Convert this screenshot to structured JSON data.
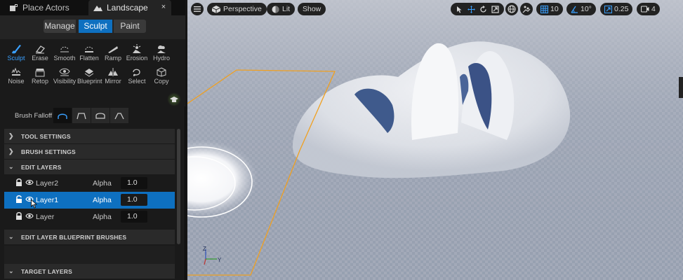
{
  "tabs": [
    {
      "label": "Place Actors",
      "icon": "place-actors-icon"
    },
    {
      "label": "Landscape",
      "icon": "landscape-icon",
      "close": "×"
    }
  ],
  "modes": [
    "Manage",
    "Sculpt",
    "Paint"
  ],
  "active_mode": "Sculpt",
  "tools_row1": [
    {
      "label": "Sculpt",
      "icon": "sculpt-brush-icon",
      "active": true
    },
    {
      "label": "Erase",
      "icon": "erase-icon"
    },
    {
      "label": "Smooth",
      "icon": "smooth-icon"
    },
    {
      "label": "Flatten",
      "icon": "flatten-icon"
    },
    {
      "label": "Ramp",
      "icon": "ramp-icon"
    },
    {
      "label": "Erosion",
      "icon": "erosion-icon"
    },
    {
      "label": "Hydro",
      "icon": "hydro-icon"
    }
  ],
  "tools_row2": [
    {
      "label": "Noise",
      "icon": "noise-icon"
    },
    {
      "label": "Retop",
      "icon": "retop-icon"
    },
    {
      "label": "Visibility",
      "icon": "visibility-icon"
    },
    {
      "label": "Blueprint",
      "icon": "blueprint-icon"
    },
    {
      "label": "Mirror",
      "icon": "mirror-icon"
    },
    {
      "label": "Select",
      "icon": "select-icon"
    },
    {
      "label": "Copy",
      "icon": "copy-icon"
    }
  ],
  "brush_falloff": {
    "label": "Brush Falloff",
    "options": [
      "smooth-falloff-icon",
      "linear-falloff-icon",
      "spherical-falloff-icon",
      "tip-falloff-icon"
    ],
    "active_index": 0
  },
  "sections": {
    "tool_settings": "TOOL SETTINGS",
    "brush_settings": "BRUSH SETTINGS",
    "edit_layers": "EDIT LAYERS",
    "blueprint_brushes": "EDIT LAYER BLUEPRINT BRUSHES",
    "target_layers": "TARGET LAYERS"
  },
  "layers": [
    {
      "name": "Layer2",
      "blend": "Alpha",
      "value": "1.0",
      "selected": false
    },
    {
      "name": "Layer1",
      "blend": "Alpha",
      "value": "1.0",
      "selected": true
    },
    {
      "name": "Layer",
      "blend": "Alpha",
      "value": "1.0",
      "selected": false
    }
  ],
  "viewport": {
    "view_mode": "Perspective",
    "lit": "Lit",
    "show": "Show",
    "grid_snap": "10",
    "rotation_snap": "10°",
    "scale_snap": "0.25",
    "camera_speed": "4",
    "axis_labels": {
      "z": "Z",
      "y": "Y"
    },
    "colors": {
      "selection_outline": "#f0a020",
      "sky": "#9ea5b4",
      "accent": "#0e70c0"
    }
  }
}
